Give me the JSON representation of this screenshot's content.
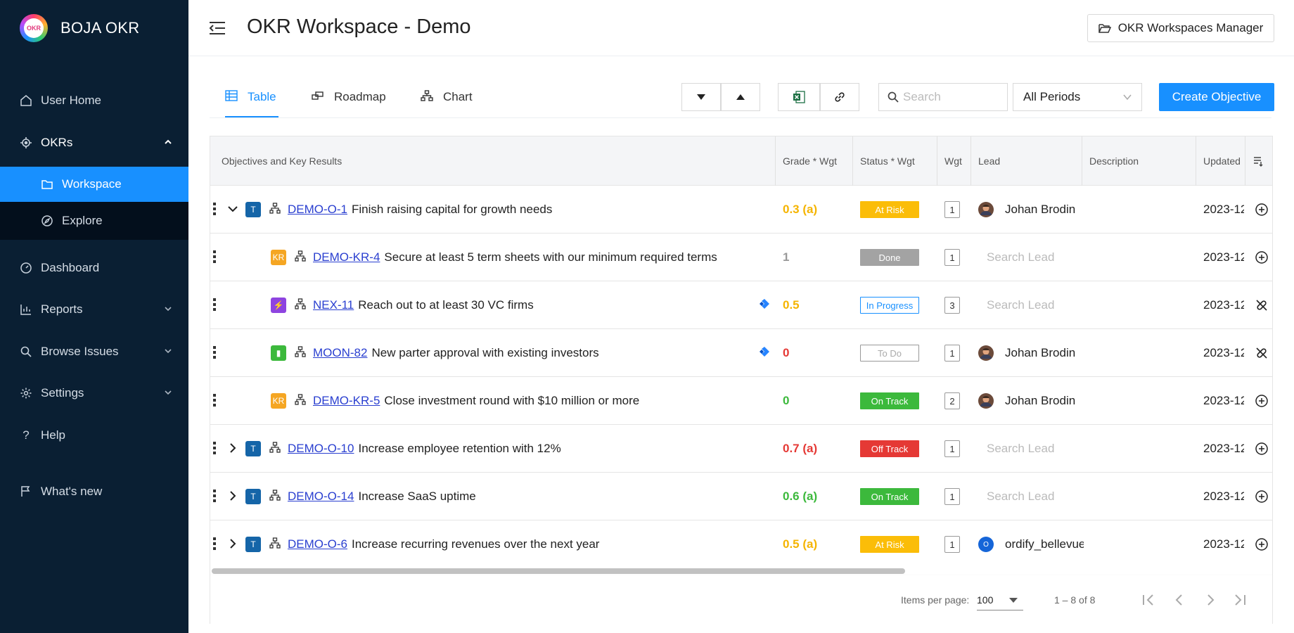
{
  "app": {
    "name": "BOJA OKR",
    "logo_text": "OKR"
  },
  "sidebar": {
    "items": [
      {
        "label": "User Home"
      },
      {
        "label": "OKRs"
      },
      {
        "label": "Workspace"
      },
      {
        "label": "Explore"
      },
      {
        "label": "Dashboard"
      },
      {
        "label": "Reports"
      },
      {
        "label": "Browse Issues"
      },
      {
        "label": "Settings"
      },
      {
        "label": "Help"
      },
      {
        "label": "What's new"
      }
    ]
  },
  "header": {
    "title": "OKR Workspace - Demo",
    "manager_button": "OKR Workspaces Manager"
  },
  "tabs": [
    {
      "label": "Table"
    },
    {
      "label": "Roadmap"
    },
    {
      "label": "Chart"
    }
  ],
  "toolbar": {
    "search_placeholder": "Search",
    "period_value": "All Periods",
    "create_button": "Create Objective"
  },
  "table": {
    "columns": [
      "Objectives and Key Results",
      "Grade * Wgt",
      "Status * Wgt",
      "Wgt",
      "Lead",
      "Description",
      "Updated"
    ],
    "lead_placeholder": "Search Lead",
    "rows": [
      {
        "badge": "T",
        "key": "DEMO-O-1",
        "summary": "Finish raising capital for growth needs",
        "grade": "0.3 (a)",
        "status": "At Risk",
        "wgt": "1",
        "lead": "Johan Brodin",
        "updated": "2023-12"
      },
      {
        "badge": "KR",
        "key": "DEMO-KR-4",
        "summary": "Secure at least 5 term sheets with our minimum required terms",
        "grade": "1",
        "status": "Done",
        "wgt": "1",
        "lead": "",
        "updated": "2023-12"
      },
      {
        "badge": "⚡",
        "key": "NEX-11",
        "summary": "Reach out to at least 30 VC firms",
        "grade": "0.5",
        "status": "In Progress",
        "wgt": "3",
        "lead": "",
        "updated": "2023-12"
      },
      {
        "badge": "▮",
        "key": "MOON-82",
        "summary": "New parter approval with existing investors",
        "grade": "0",
        "status": "To Do",
        "wgt": "1",
        "lead": "Johan Brodin",
        "updated": "2023-12"
      },
      {
        "badge": "KR",
        "key": "DEMO-KR-5",
        "summary": "Close investment round with $10 million or more",
        "grade": "0",
        "status": "On Track",
        "wgt": "2",
        "lead": "Johan Brodin",
        "updated": "2023-12"
      },
      {
        "badge": "T",
        "key": "DEMO-O-10",
        "summary": "Increase employee retention with 12%",
        "grade": "0.7 (a)",
        "status": "Off Track",
        "wgt": "1",
        "lead": "",
        "updated": "2023-12"
      },
      {
        "badge": "T",
        "key": "DEMO-O-14",
        "summary": "Increase SaaS uptime",
        "grade": "0.6 (a)",
        "status": "On Track",
        "wgt": "1",
        "lead": "",
        "updated": "2023-12"
      },
      {
        "badge": "T",
        "key": "DEMO-O-6",
        "summary": "Increase recurring revenues over the next year",
        "grade": "0.5 (a)",
        "status": "At Risk",
        "wgt": "1",
        "lead": "ordify_bellevue",
        "lead_initial": "O",
        "updated": "2023-12"
      }
    ]
  },
  "pagination": {
    "items_per_page_label": "Items per page:",
    "items_per_page": "100",
    "range": "1 – 8 of 8"
  },
  "colors": {
    "accent": "#1890ff",
    "sidebar": "#0a1f33",
    "at_risk": "#fbbd08",
    "on_track": "#3cb93c",
    "off_track": "#e53935",
    "done": "#9e9e9e",
    "in_progress": "#1890ff",
    "kr": "#f5a623",
    "objective": "#1565a8"
  }
}
